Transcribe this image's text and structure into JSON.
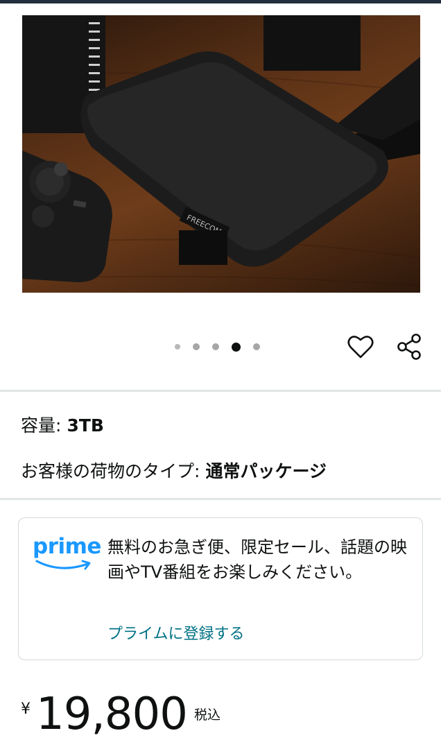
{
  "product": {
    "image_alt": "FREECOM 外付けハードディスク",
    "brand_tag": "FREECOM",
    "carousel": {
      "total": 5,
      "active_index": 3
    }
  },
  "actions": {
    "favorite_icon": "heart-icon",
    "share_icon": "share-icon"
  },
  "attributes": [
    {
      "label": "容量:",
      "value": "3TB"
    },
    {
      "label": "お客様の荷物のタイプ:",
      "value": "通常パッケージ"
    }
  ],
  "prime": {
    "logo_text": "prime",
    "description": "無料のお急ぎ便、限定セール、話題の映画やTV番組をお楽しみください。",
    "link": "プライムに登録する",
    "colors": {
      "logo": "#1a98ff",
      "link": "#007185"
    }
  },
  "price": {
    "currency": "¥",
    "amount": "19,800",
    "tax_note": "税込"
  }
}
